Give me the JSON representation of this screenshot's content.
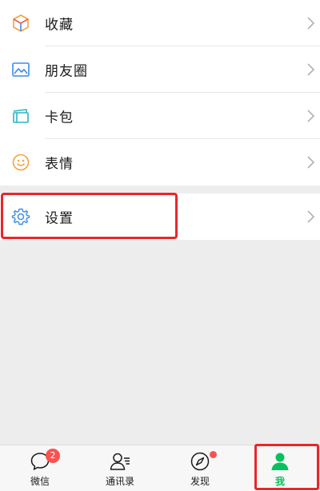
{
  "menu": {
    "group1": [
      {
        "label": "收藏",
        "icon": "favorites-cube-icon"
      },
      {
        "label": "朋友圈",
        "icon": "moments-picture-icon"
      },
      {
        "label": "卡包",
        "icon": "card-wallet-icon"
      },
      {
        "label": "表情",
        "icon": "sticker-smile-icon"
      }
    ],
    "group2": [
      {
        "label": "设置",
        "icon": "settings-gear-icon"
      }
    ]
  },
  "tabbar": {
    "tabs": [
      {
        "label": "微信",
        "icon": "chat-bubble-icon",
        "badge": "2"
      },
      {
        "label": "通讯录",
        "icon": "contacts-icon"
      },
      {
        "label": "发现",
        "icon": "discover-compass-icon",
        "dot": true
      },
      {
        "label": "我",
        "icon": "me-person-icon",
        "active": true
      }
    ]
  },
  "colors": {
    "accent_green": "#07c160",
    "badge_red": "#fa5151",
    "highlight_red": "#e8262a",
    "background": "#ededed"
  }
}
